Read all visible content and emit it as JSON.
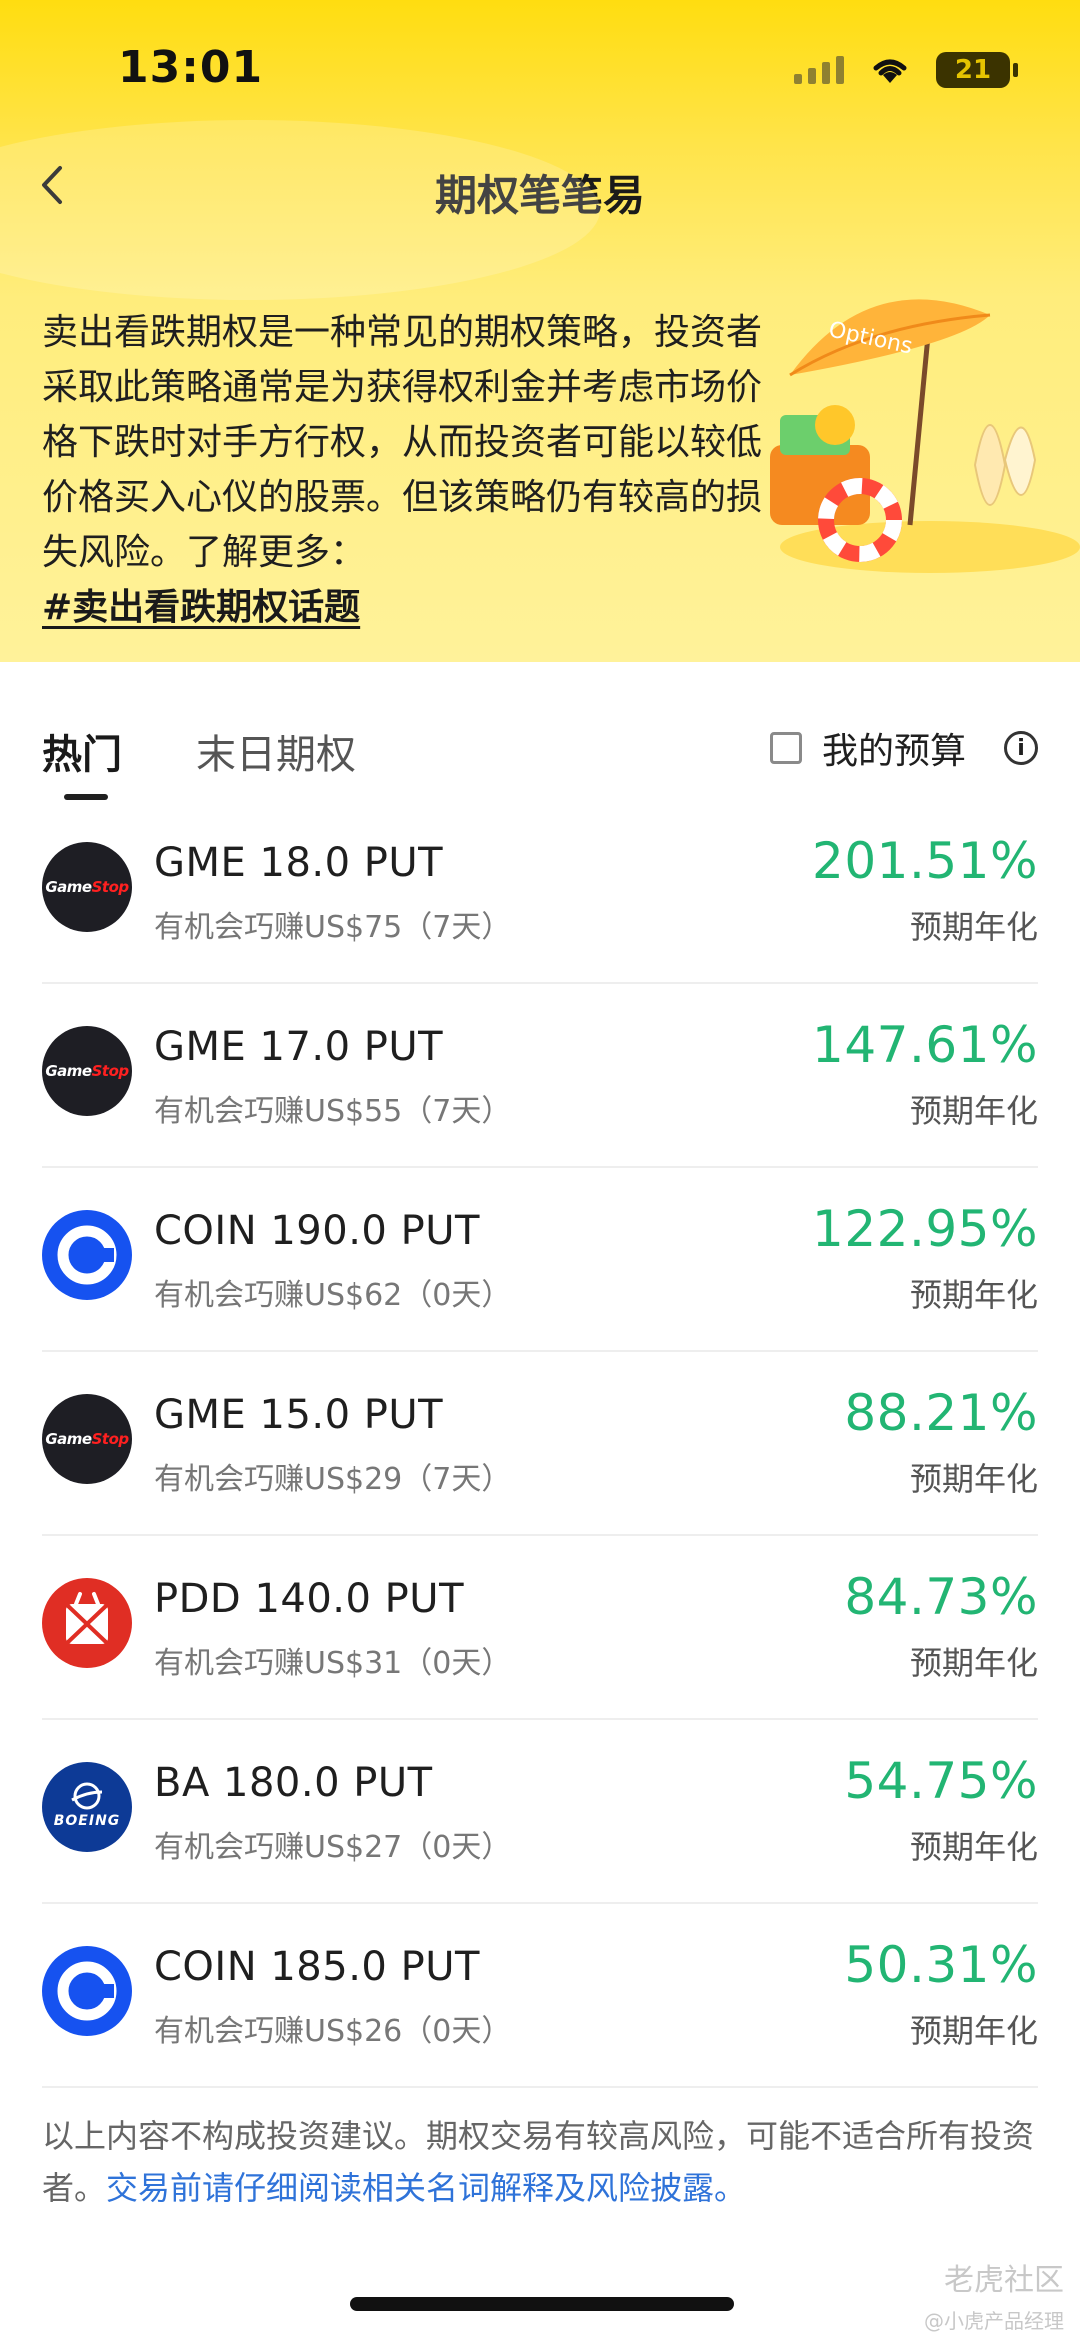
{
  "status_bar": {
    "time": "13:01",
    "battery": "21"
  },
  "header": {
    "title": "期权笔笔易"
  },
  "intro": {
    "text": "卖出看跌期权是一种常见的期权策略，投资者采取此策略通常是为获得权利金并考虑市场价格下跌时对手方行权，从而投资者可能以较低价格买入心仪的股票。但该策略仍有较高的损失风险。了解更多：",
    "link": "#卖出看跌期权话题",
    "illustration_text": "Options"
  },
  "tabs": [
    {
      "label": "热门",
      "active": true
    },
    {
      "label": "末日期权",
      "active": false
    }
  ],
  "budget": {
    "label": "我的预算",
    "checked": false
  },
  "options": [
    {
      "logo": "GameStop",
      "name": "GME 18.0 PUT",
      "sub": "有机会巧赚US$75（7天）",
      "pct": "201.51%",
      "pct_label": "预期年化"
    },
    {
      "logo": "GameStop",
      "name": "GME 17.0 PUT",
      "sub": "有机会巧赚US$55（7天）",
      "pct": "147.61%",
      "pct_label": "预期年化"
    },
    {
      "logo": "coin",
      "name": "COIN 190.0 PUT",
      "sub": "有机会巧赚US$62（0天）",
      "pct": "122.95%",
      "pct_label": "预期年化"
    },
    {
      "logo": "GameStop",
      "name": "GME 15.0 PUT",
      "sub": "有机会巧赚US$29（7天）",
      "pct": "88.21%",
      "pct_label": "预期年化"
    },
    {
      "logo": "pdd",
      "name": "PDD 140.0 PUT",
      "sub": "有机会巧赚US$31（0天）",
      "pct": "84.73%",
      "pct_label": "预期年化"
    },
    {
      "logo": "BOEING",
      "name": "BA 180.0 PUT",
      "sub": "有机会巧赚US$27（0天）",
      "pct": "54.75%",
      "pct_label": "预期年化"
    },
    {
      "logo": "coin",
      "name": "COIN 185.0 PUT",
      "sub": "有机会巧赚US$26（0天）",
      "pct": "50.31%",
      "pct_label": "预期年化"
    }
  ],
  "disclaimer": {
    "text": "以上内容不构成投资建议。期权交易有较高风险，可能不适合所有投资者。",
    "link": "交易前请仔细阅读相关名词解释及风险披露。"
  },
  "watermark": {
    "line1": "老虎社区",
    "line2": "@小虎产品经理"
  },
  "colors": {
    "accent_green": "#22b573",
    "hero_yellow": "#ffdd10",
    "link_blue": "#2f73d9"
  }
}
